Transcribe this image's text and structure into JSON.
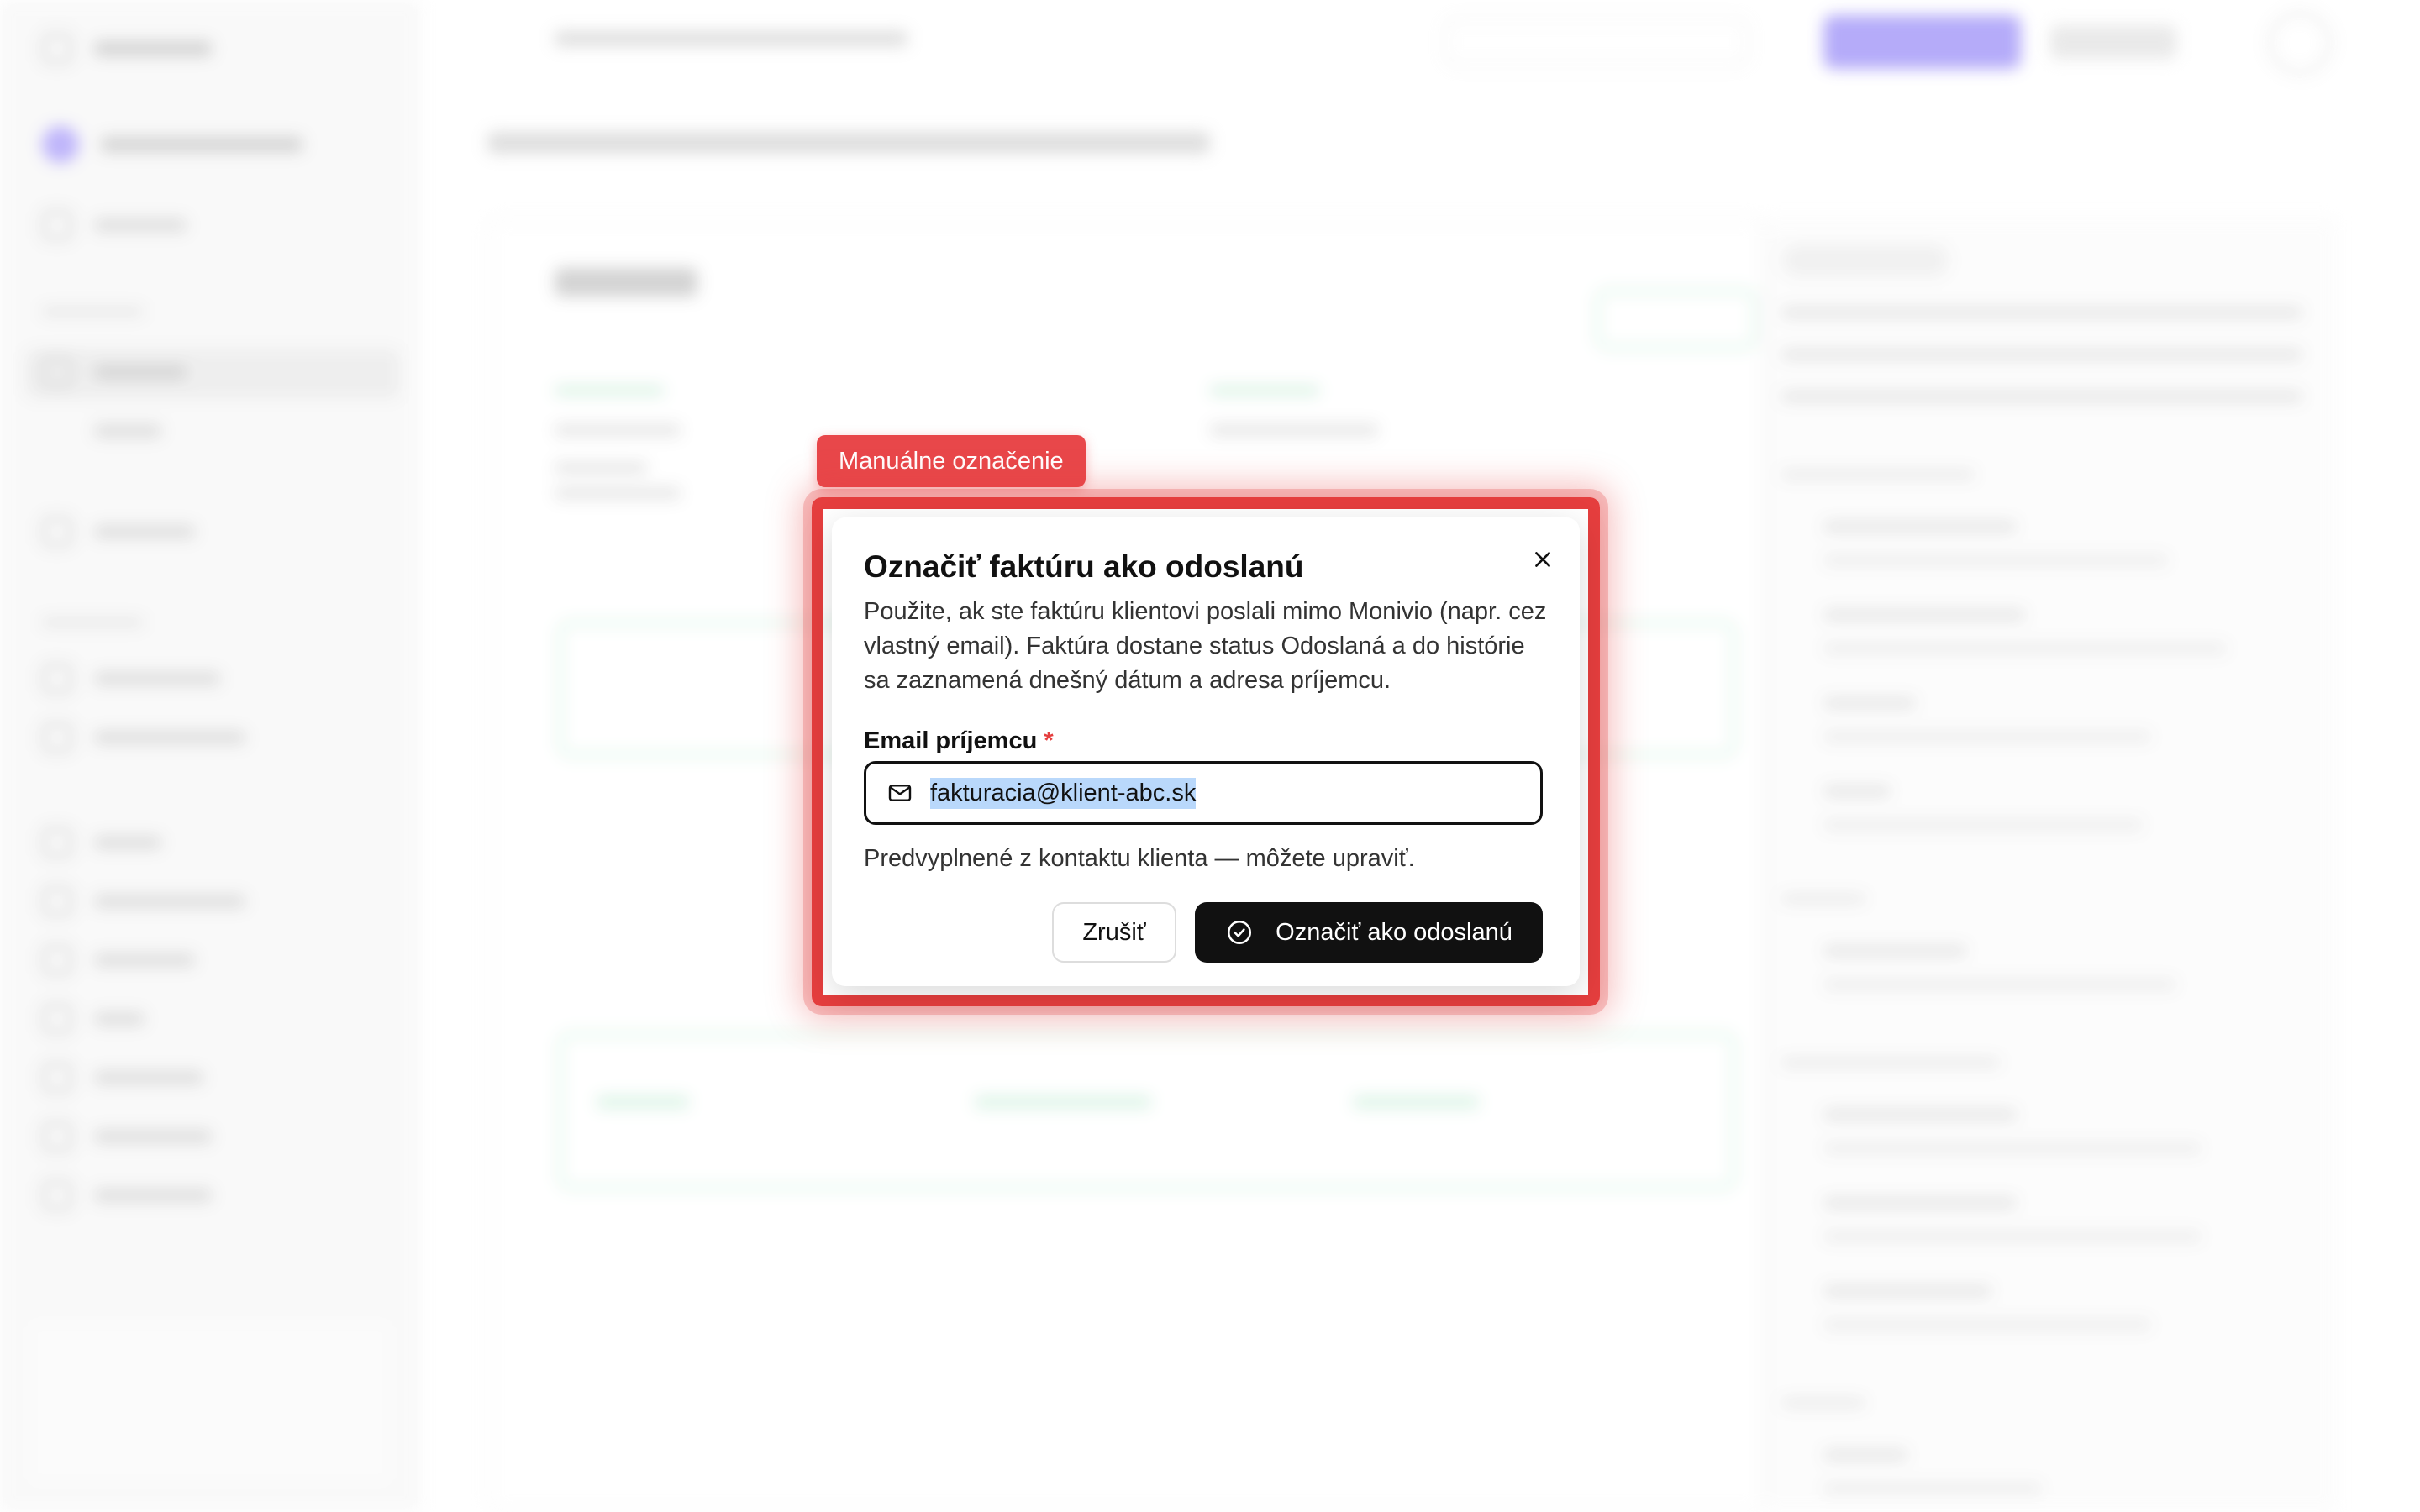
{
  "annotation": {
    "label": "Manuálne označenie"
  },
  "dialog": {
    "title": "Označiť faktúru ako odoslanú",
    "description": "Použite, ak ste faktúru klientovi poslali mimo Monivio (napr. cez vlastný email). Faktúra dostane status Odoslaná a do histórie sa zaznamená dnešný dátum a adresa príjemcu.",
    "email_label": "Email príjemcu",
    "required_mark": "*",
    "email_value": "fakturacia@klient-abc.sk",
    "hint": "Predvyplnené z kontaktu klienta — môžete upraviť.",
    "cancel_label": "Zrušiť",
    "confirm_label": "Označiť ako odoslanú"
  },
  "colors": {
    "annotation_red": "#e53e3e",
    "primary_button": "#111111",
    "selection_highlight": "#b9d8fb"
  },
  "icons": [
    "close-icon",
    "mail-icon",
    "check-circle-icon"
  ]
}
